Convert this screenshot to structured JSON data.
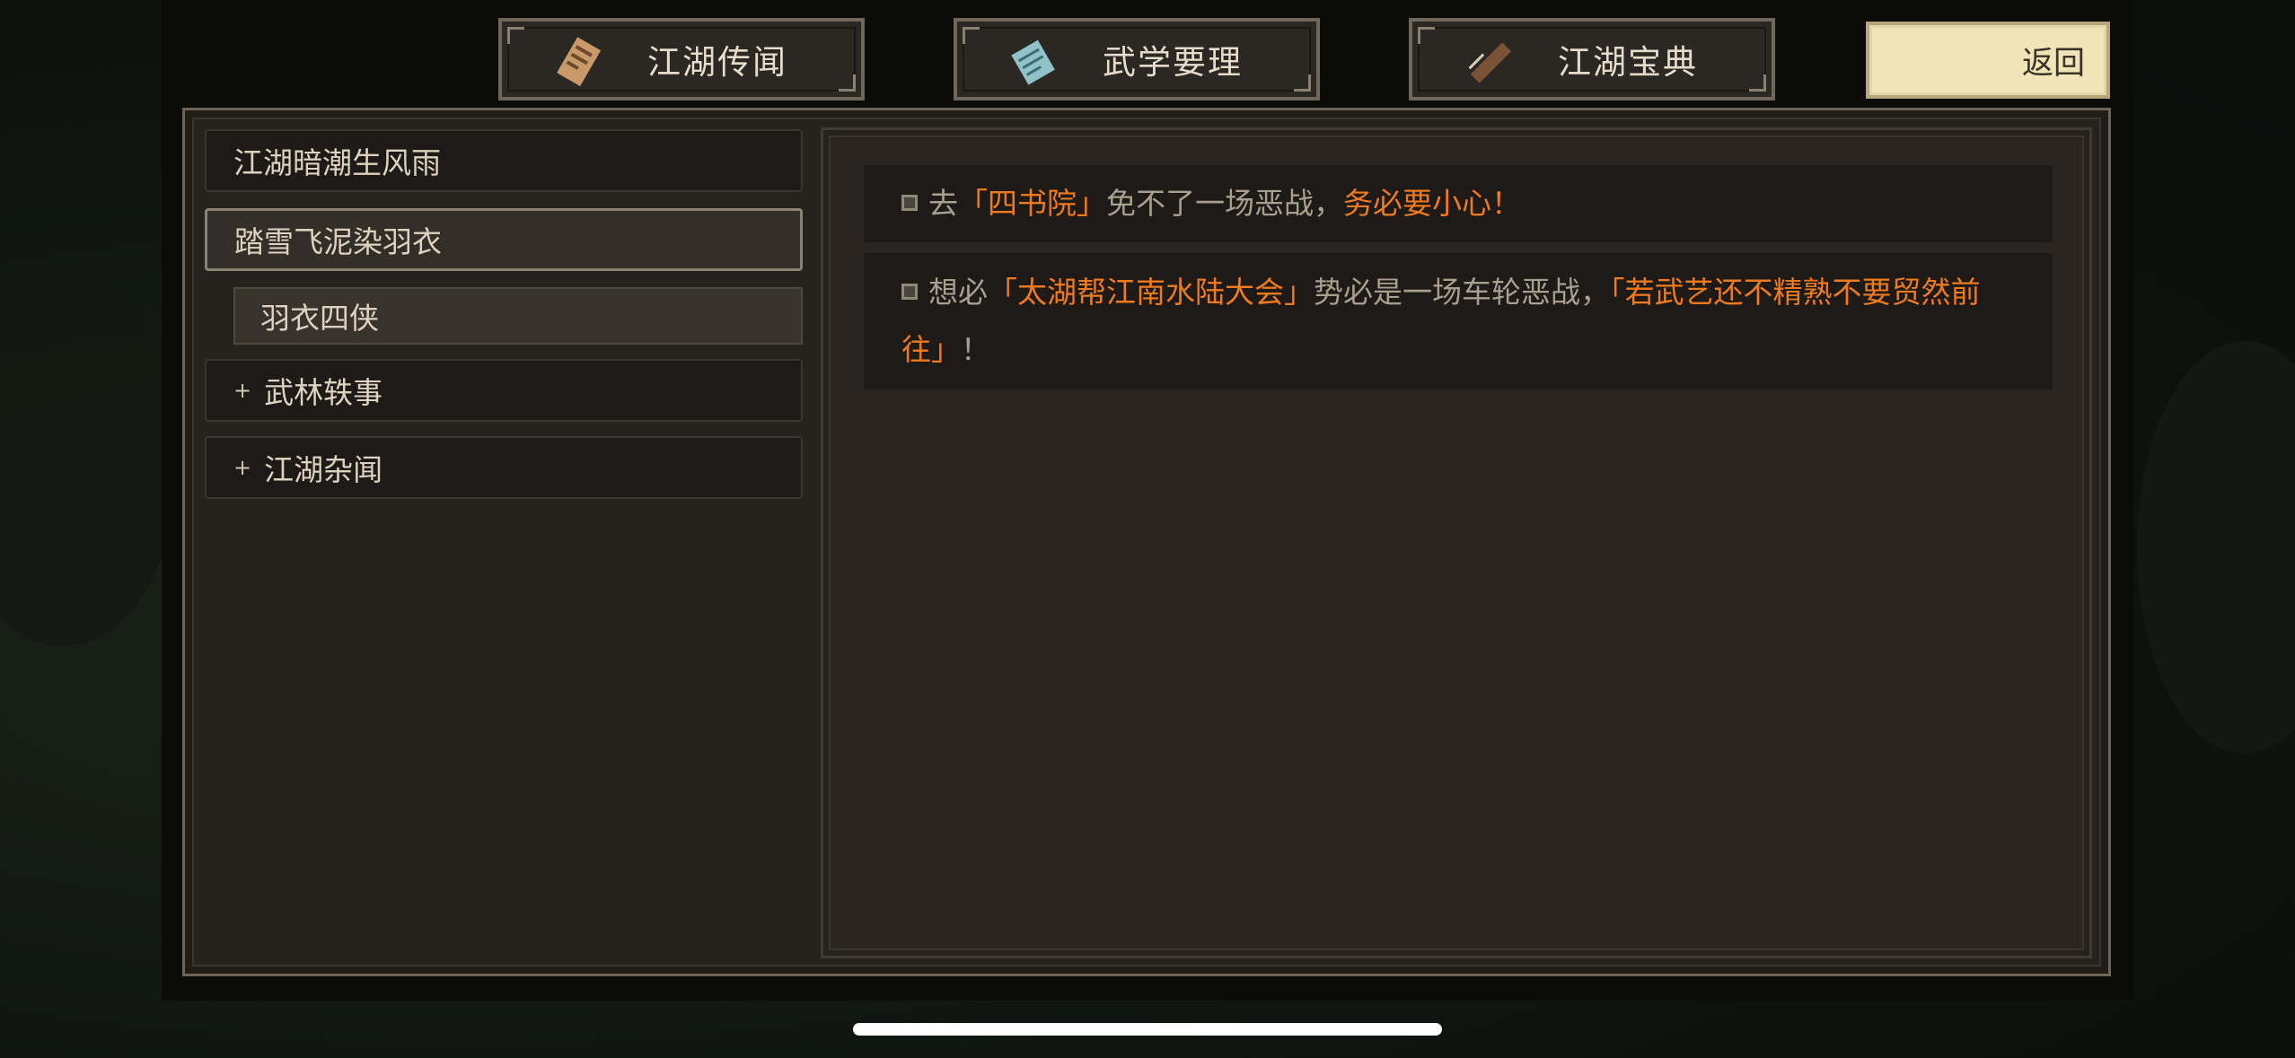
{
  "tabs": [
    {
      "label": "江湖传闻",
      "icon": "scroll-letter-icon"
    },
    {
      "label": "武学要理",
      "icon": "martial-manual-icon"
    },
    {
      "label": "江湖宝典",
      "icon": "brush-scroll-icon"
    }
  ],
  "back_label": "返回",
  "sidebar": {
    "items": [
      {
        "label": "江湖暗潮生风雨"
      },
      {
        "label": "踏雪飞泥染羽衣"
      },
      {
        "label": "羽衣四侠"
      },
      {
        "prefix": "+",
        "label": "武林轶事"
      },
      {
        "prefix": "+",
        "label": "江湖杂闻"
      }
    ]
  },
  "entries": [
    {
      "parts": [
        {
          "text": "去",
          "hl": false
        },
        {
          "text": "「四书院」",
          "hl": true
        },
        {
          "text": "免不了一场恶战，",
          "hl": false
        },
        {
          "text": "务必要小心！",
          "hl": true
        }
      ]
    },
    {
      "parts": [
        {
          "text": "想必",
          "hl": false
        },
        {
          "text": "「太湖帮江南水陆大会」",
          "hl": true
        },
        {
          "text": "势必是一场车轮恶战，",
          "hl": false
        },
        {
          "text": "「若武艺还不精熟不要贸然前往」",
          "hl": true
        },
        {
          "text": "！",
          "hl": false
        }
      ]
    }
  ],
  "colors": {
    "highlight": "#f07a1e",
    "text": "#a89f8f",
    "panel": "#26221e",
    "back_button": "#f1e4b8"
  }
}
